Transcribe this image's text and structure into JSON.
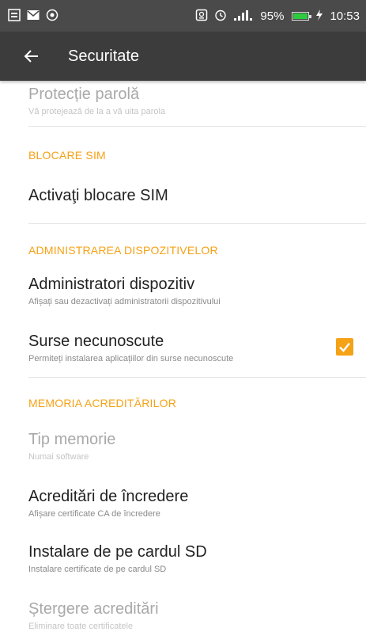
{
  "status_bar": {
    "left_icons": [
      "gallery-icon",
      "mail-icon",
      "record-icon"
    ],
    "right_icons": [
      "nfc-icon",
      "alarm-icon",
      "signal-icon"
    ],
    "battery_percent": "95%",
    "battery_level": 0.95,
    "time": "10:53",
    "accent_battery": "#2ecc40"
  },
  "app_bar": {
    "title": "Securitate",
    "background": "#3c3c3c"
  },
  "colors": {
    "accent": "#f5a216",
    "text": "#222222",
    "secondary": "#8a8a8a"
  },
  "items": {
    "password_protection": {
      "title": "Protecție parolă",
      "subtitle": "Vă protejează de la a vă uita parola"
    },
    "sim_lock": {
      "title": "Activaţi blocare SIM"
    },
    "device_admins": {
      "title": "Administratori dispozitiv",
      "subtitle": "Afișați sau dezactivați administratorii dispozitivului"
    },
    "unknown_sources": {
      "title": "Surse necunoscute",
      "subtitle": "Permiteți instalarea aplicațiilor din surse necunoscute",
      "checked": true
    },
    "storage_type": {
      "title": "Tip memorie",
      "subtitle": "Numai software"
    },
    "trusted_credentials": {
      "title": "Acreditări de încredere",
      "subtitle": "Afișare certificate CA de încredere"
    },
    "install_sd": {
      "title": "Instalare de pe cardul SD",
      "subtitle": "Instalare certificate de pe cardul SD"
    },
    "clear_credentials": {
      "title": "Ștergere acreditări",
      "subtitle": "Eliminare toate certificatele"
    }
  },
  "sections": {
    "sim_lock": "BLOCARE SIM",
    "device_admin": "ADMINISTRAREA DISPOZITIVELOR",
    "credential_storage": "MEMORIA ACREDITĂRILOR"
  }
}
